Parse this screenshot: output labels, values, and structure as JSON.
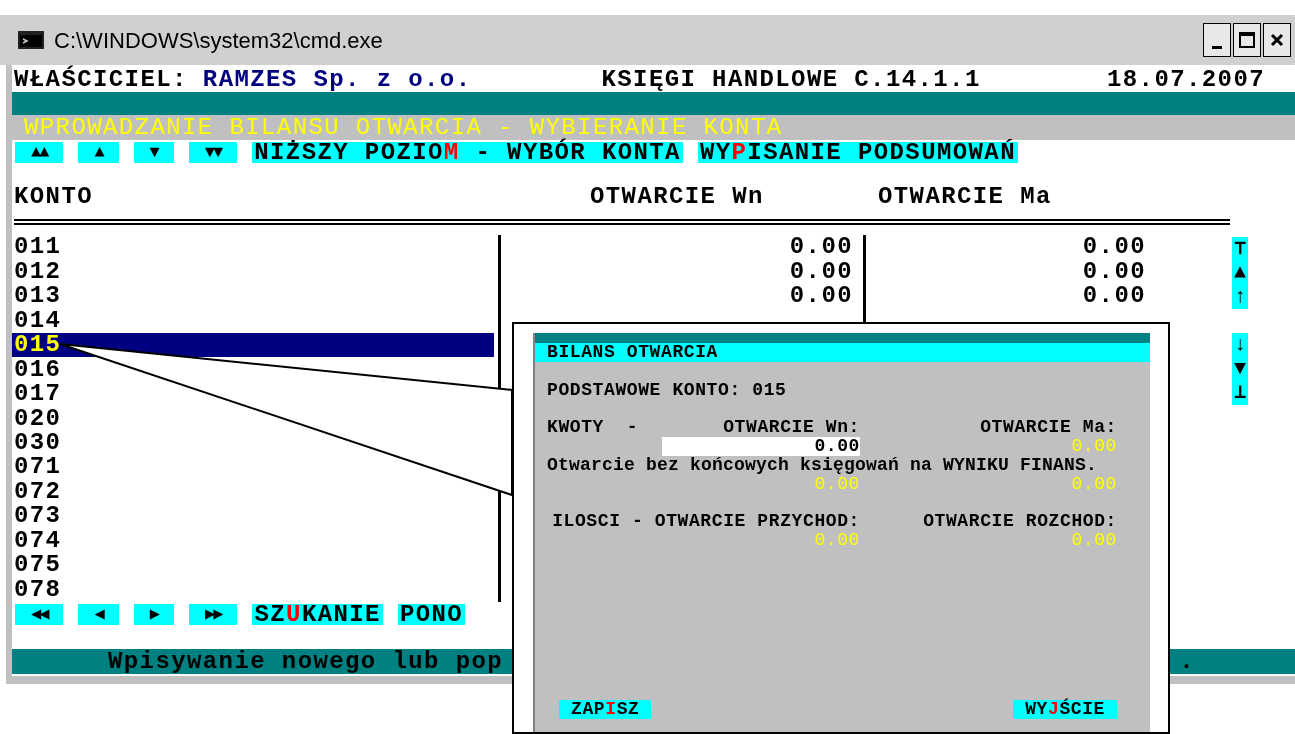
{
  "window": {
    "title": "C:\\WINDOWS\\system32\\cmd.exe"
  },
  "header": {
    "owner_label": "WŁAŚCICIEL:",
    "owner": "RAMZES Sp. z o.o.",
    "program": "KSIĘGI HANDLOWE C.14.1.1",
    "date": "18.07.2007"
  },
  "screen_title": "WPROWADZANIE BILANSU OTWARCIA - WYBIERANIE KONTA",
  "top_keys": [
    {
      "kind": "arrow",
      "label": "▲▲"
    },
    {
      "kind": "arrow",
      "label": "▲"
    },
    {
      "kind": "arrow",
      "label": "▼"
    },
    {
      "kind": "arrow",
      "label": "▼▼"
    },
    {
      "kind": "command",
      "before": "NIŻSZY POZIO",
      "hotkey": "M",
      "after": " - WYBÓR KONTA"
    },
    {
      "kind": "command",
      "before": "WY",
      "hotkey": "P",
      "after": "ISANIE PODSUMOWAŃ"
    }
  ],
  "columns": [
    "KONTO",
    "OTWARCIE Wn",
    "OTWARCIE Ma"
  ],
  "rows": [
    {
      "account": "011",
      "wn": "0.00",
      "ma": "0.00",
      "selected": false
    },
    {
      "account": "012",
      "wn": "0.00",
      "ma": "0.00",
      "selected": false
    },
    {
      "account": "013",
      "wn": "0.00",
      "ma": "0.00",
      "selected": false
    },
    {
      "account": "014",
      "selected": false
    },
    {
      "account": "015",
      "selected": true
    },
    {
      "account": "016",
      "selected": false
    },
    {
      "account": "017",
      "selected": false
    },
    {
      "account": "020",
      "selected": false
    },
    {
      "account": "030",
      "selected": false
    },
    {
      "account": "071",
      "selected": false
    },
    {
      "account": "072",
      "selected": false
    },
    {
      "account": "073",
      "selected": false
    },
    {
      "account": "074",
      "selected": false
    },
    {
      "account": "075",
      "selected": false
    },
    {
      "account": "078",
      "selected": false
    }
  ],
  "scroll_indicator": {
    "up": [
      "⊤",
      "▲",
      "↑"
    ],
    "down": [
      "↓",
      "▼",
      "⊥"
    ]
  },
  "bottom_keys": [
    {
      "kind": "arrow",
      "label": "◀◀"
    },
    {
      "kind": "arrow",
      "label": "◀"
    },
    {
      "kind": "arrow",
      "label": "▶"
    },
    {
      "kind": "arrow",
      "label": "▶▶"
    },
    {
      "kind": "command",
      "before": "SZ",
      "hotkey": "U",
      "after": "KANIE"
    },
    {
      "kind": "command",
      "before": "PONO"
    }
  ],
  "status_bar": {
    "text": "Wpisywanie nowego lub pop",
    "tail": "."
  },
  "dialog": {
    "title": "BILANS OTWARCIA",
    "account_line": "PODSTAWOWE KONTO: 015",
    "amounts_label": "KWOTY  -",
    "wn_label": "OTWARCIE Wn:",
    "ma_label": "OTWARCIE Ma:",
    "wn_value": "0.00",
    "ma_value": "0.00",
    "note": "Otwarcie bez końcowych księgowań na WYNIKU FINANS.",
    "note_wn": "0.00",
    "note_ma": "0.00",
    "qty_in_label": "ILOSCI - OTWARCIE PRZYCHOD:",
    "qty_out_label": "OTWARCIE ROZCHOD:",
    "qty_in": "0.00",
    "qty_out": "0.00",
    "buttons": [
      {
        "before": "ZAP",
        "hotkey": "I",
        "after": "SZ"
      },
      {
        "before": "WY",
        "hotkey": "J",
        "after": "ŚCIE"
      }
    ]
  }
}
